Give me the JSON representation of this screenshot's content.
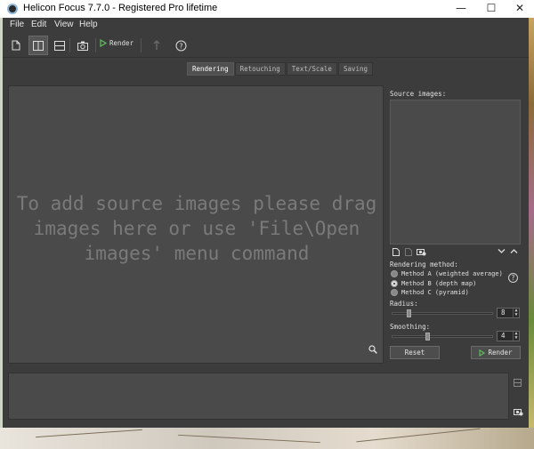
{
  "window": {
    "title": "Helicon Focus 7.7.0 - Registered Pro lifetime",
    "minimize_glyph": "—",
    "maximize_glyph": "☐",
    "close_glyph": "✕"
  },
  "menu": {
    "items": [
      "File",
      "Edit",
      "View",
      "Help"
    ]
  },
  "toolbar": {
    "render_label": "Render",
    "help_glyph": "?"
  },
  "tabs": [
    {
      "label": "Rendering",
      "active": true
    },
    {
      "label": "Retouching",
      "active": false
    },
    {
      "label": "Text/Scale",
      "active": false
    },
    {
      "label": "Saving",
      "active": false
    }
  ],
  "canvas": {
    "hint": "To add source images please drag\nimages here or use 'File\\Open\nimages' menu command"
  },
  "panel": {
    "source_images_label": "Source images:",
    "rendering_method_label": "Rendering method:",
    "methods": [
      {
        "label": "Method A (weighted average)",
        "selected": false
      },
      {
        "label": "Method B (depth map)",
        "selected": true
      },
      {
        "label": "Method C (pyramid)",
        "selected": false
      }
    ],
    "help_glyph": "?",
    "radius_label": "Radius:",
    "radius_value": "8",
    "radius_fraction": 0.15,
    "smoothing_label": "Smoothing:",
    "smoothing_value": "4",
    "smoothing_fraction": 0.33,
    "reset_label": "Reset",
    "render_label": "Render"
  },
  "colors": {
    "background": "#3c3c3c",
    "canvas": "#4a4a4a",
    "render_play": "#5ec15e"
  }
}
